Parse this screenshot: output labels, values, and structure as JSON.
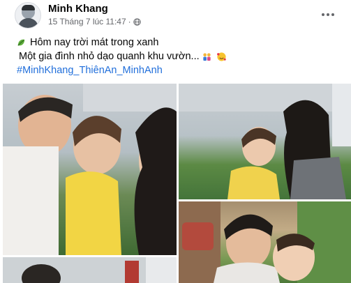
{
  "post": {
    "author": "Minh Khang",
    "timestamp": "15 Tháng 7 lúc 11:47",
    "separator": "·",
    "audience_icon": "globe-icon",
    "more_icon": "more-options-icon",
    "lines": [
      "Hôm nay trời mát trong xanh",
      "Một gia đình nhỏ dạo quanh khu vườn..."
    ],
    "hashtag": "#MinhKhang_ThiênAn_MinhAnh",
    "emoji_icons": [
      "leaf-emoji-icon",
      "family-emoji-icon",
      "smiling-hearts-emoji-icon"
    ]
  },
  "photos": {
    "count": 4,
    "items": [
      "photo-1",
      "photo-2",
      "photo-3",
      "photo-4"
    ]
  },
  "colors": {
    "text": "#050505",
    "meta": "#65676b",
    "hashtag": "#216fdb"
  }
}
